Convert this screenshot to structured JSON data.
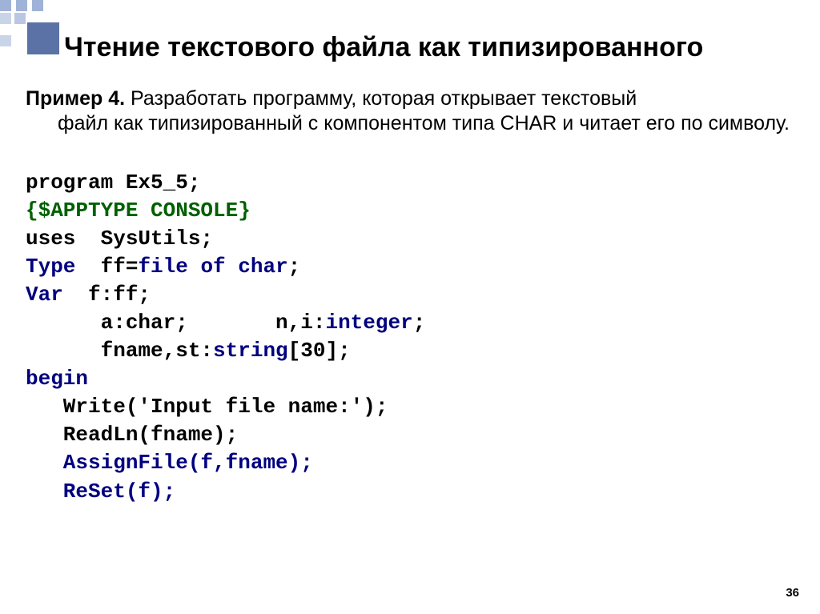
{
  "title": "Чтение текстового файла как типизированного",
  "example": {
    "label": "Пример 4.",
    "line1_rest": " Разработать программу, которая открывает текстовый",
    "line2": "файл как типизированный с компонентом типа CHAR и читает его по символу."
  },
  "code": {
    "l1_black": "program Ex5_5;",
    "l2_green": "{$APPTYPE CONSOLE}",
    "l3_black": "uses  SysUtils;",
    "l4_type_kw": "Type",
    "l4_mid": "  ff=",
    "l4_fileof": "file of char",
    "l4_semi": ";",
    "l5_var_kw": "Var",
    "l5_rest": "  f:ff;",
    "l6_black": "      a:char;       n,i:",
    "l6_int": "integer",
    "l6_semi": ";",
    "l7_black": "      fname,st:",
    "l7_str": "string",
    "l7_tail": "[30];",
    "l8_begin": "begin",
    "l9_black": "   Write('Input file name:');",
    "l10_black": "   ReadLn(fname);",
    "l11_navy": "   AssignFile(f,fname);",
    "l12_navy": "   ReSet(f);"
  },
  "page_number": "36"
}
